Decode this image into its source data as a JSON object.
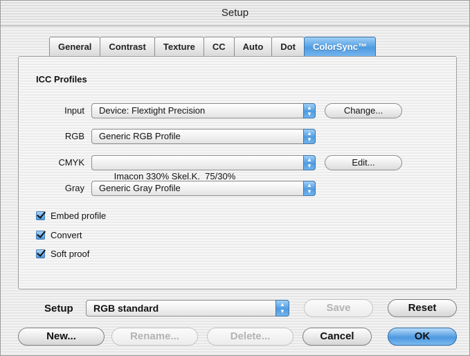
{
  "window": {
    "title": "Setup"
  },
  "tabs": [
    {
      "label": "General",
      "active": false
    },
    {
      "label": "Contrast",
      "active": false
    },
    {
      "label": "Texture",
      "active": false
    },
    {
      "label": "CC",
      "active": false
    },
    {
      "label": "Auto",
      "active": false
    },
    {
      "label": "Dot",
      "active": false
    },
    {
      "label": "ColorSync™",
      "active": true
    }
  ],
  "icc": {
    "section_title": "ICC Profiles",
    "input": {
      "label": "Input",
      "value": "Device: Flextight Precision",
      "button": "Change..."
    },
    "rgb": {
      "label": "RGB",
      "value": "Generic RGB Profile"
    },
    "cmyk": {
      "label": "CMYK",
      "value": "Imacon 330% Skel.K.  75/30%",
      "button": "Edit..."
    },
    "gray": {
      "label": "Gray",
      "value": "Generic Gray Profile"
    }
  },
  "options": [
    {
      "label": "Embed profile",
      "checked": true
    },
    {
      "label": "Convert",
      "checked": true
    },
    {
      "label": "Soft proof",
      "checked": true
    }
  ],
  "setup": {
    "label": "Setup",
    "value": "RGB standard",
    "save": "Save",
    "reset": "Reset"
  },
  "buttons": {
    "new": "New...",
    "rename": "Rename...",
    "delete": "Delete...",
    "cancel": "Cancel",
    "ok": "OK"
  },
  "colors": {
    "aqua_accent": "#4f9be0",
    "disabled_text": "#b3b3b3"
  }
}
